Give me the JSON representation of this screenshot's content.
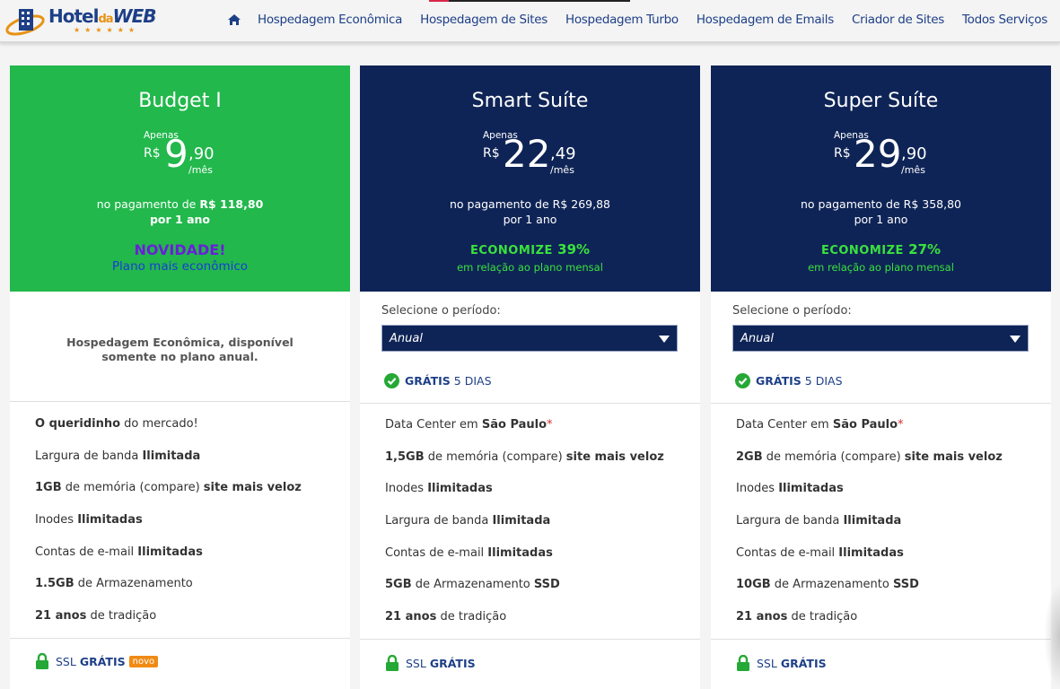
{
  "header": {
    "logo": {
      "brand_hotel": "Hotel",
      "brand_da": "da",
      "brand_web": "WEB",
      "stars": "★★★★★★"
    },
    "nav": {
      "home_icon": "home-icon",
      "items": [
        "Hospedagem Econômica",
        "Hospedagem de Sites",
        "Hospedagem Turbo",
        "Hospedagem de Emails",
        "Criador de Sites",
        "Todos Serviços"
      ]
    }
  },
  "plans": [
    {
      "name": "Budget I",
      "color": "#22b84c",
      "price": {
        "label": "Apenas",
        "currency": "R$",
        "integer": "9",
        "cents": ",90",
        "period": "/mês"
      },
      "payment_prefix": "no pagamento de",
      "payment_amount": "R$ 118,80",
      "payment_term": "por 1 ano",
      "promo_title": "NOVIDADE!",
      "promo_sub": "Plano mais econômico",
      "note": "Hospedagem Econômica, disponível",
      "note_2": "somente no plano anual.",
      "features": [
        {
          "bold": "O queridinho",
          "text": " do mercado!"
        },
        {
          "text": "Largura de banda ",
          "bold": "Ilimitada"
        },
        {
          "bold": "1GB",
          "text": " de memória (compare) ",
          "bold2": "site mais veloz"
        },
        {
          "text": "Inodes ",
          "bold": "Ilimitadas"
        },
        {
          "text": "Contas de e-mail ",
          "bold": "Ilimitadas"
        },
        {
          "bold": "1.5GB",
          "text": " de Armazenamento"
        },
        {
          "bold": "21 anos",
          "text": " de tradição"
        }
      ],
      "ssl_label": "SSL",
      "ssl_bold": "GRÁTIS",
      "ssl_badge": "novo"
    },
    {
      "name": "Smart Suíte",
      "color": "#0f2456",
      "price": {
        "label": "Apenas",
        "currency": "R$",
        "integer": "22",
        "cents": ",49",
        "period": "/mês"
      },
      "payment_prefix": "no pagamento de",
      "payment_amount": "R$ 269,88",
      "payment_term": "por 1 ano",
      "promo_label": "ECONOMIZE",
      "promo_value": "39%",
      "promo_sub": "em relação ao plano mensal",
      "period_label": "Selecione o período:",
      "period_value": "Anual",
      "trial_bold": "GRÁTIS",
      "trial_text": "5 DIAS",
      "features": [
        {
          "text": "Data Center em ",
          "bold": "São Paulo",
          "mark": "*"
        },
        {
          "bold": "1,5GB",
          "text": " de memória (compare) ",
          "bold2": "site mais veloz"
        },
        {
          "text": "Inodes ",
          "bold": "Ilimitadas"
        },
        {
          "text": "Largura de banda ",
          "bold": "Ilimitada"
        },
        {
          "text": "Contas de e-mail ",
          "bold": "Ilimitadas"
        },
        {
          "bold": "5GB",
          "text": " de Armazenamento ",
          "bold2": "SSD"
        },
        {
          "bold": "21 anos",
          "text": " de tradição"
        }
      ],
      "ssl_label": "SSL",
      "ssl_bold": "GRÁTIS"
    },
    {
      "name": "Super Suíte",
      "color": "#0f2456",
      "price": {
        "label": "Apenas",
        "currency": "R$",
        "integer": "29",
        "cents": ",90",
        "period": "/mês"
      },
      "payment_prefix": "no pagamento de",
      "payment_amount": "R$ 358,80",
      "payment_term": "por 1 ano",
      "promo_label": "ECONOMIZE",
      "promo_value": "27%",
      "promo_sub": "em relação ao plano mensal",
      "period_label": "Selecione o período:",
      "period_value": "Anual",
      "trial_bold": "GRÁTIS",
      "trial_text": "5 DIAS",
      "features": [
        {
          "text": "Data Center em ",
          "bold": "São Paulo",
          "mark": "*"
        },
        {
          "bold": "2GB",
          "text": " de memória (compare) ",
          "bold2": "site mais veloz"
        },
        {
          "text": "Inodes ",
          "bold": "Ilimitadas"
        },
        {
          "text": "Largura de banda ",
          "bold": "Ilimitada"
        },
        {
          "text": "Contas de e-mail ",
          "bold": "Ilimitadas"
        },
        {
          "bold": "10GB",
          "text": " de Armazenamento ",
          "bold2": "SSD"
        },
        {
          "bold": "21 anos",
          "text": " de tradição"
        }
      ],
      "ssl_label": "SSL",
      "ssl_bold": "GRÁTIS"
    }
  ]
}
